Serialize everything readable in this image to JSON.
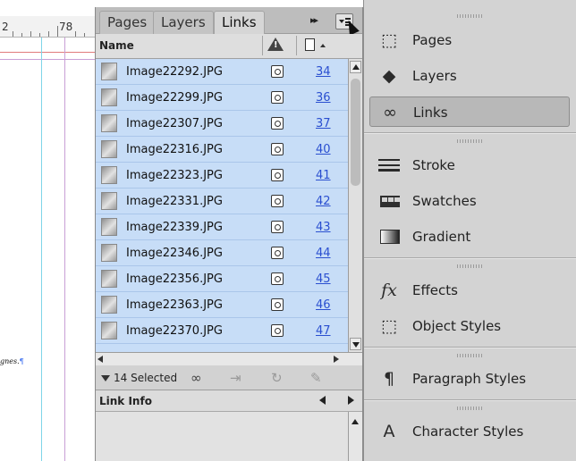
{
  "ruler": {
    "number": "78",
    "partial": "2"
  },
  "doc_snippet": {
    "text": "gnes.",
    "pilcrow": "¶"
  },
  "links_panel": {
    "tabs": [
      {
        "label": "Pages",
        "active": false
      },
      {
        "label": "Layers",
        "active": false
      },
      {
        "label": "Links",
        "active": true
      }
    ],
    "collapse_label": "▸▸",
    "column_name": "Name",
    "rows": [
      {
        "name": "Image22292.JPG",
        "page": "34"
      },
      {
        "name": "Image22299.JPG",
        "page": "36"
      },
      {
        "name": "Image22307.JPG",
        "page": "37"
      },
      {
        "name": "Image22316.JPG",
        "page": "40"
      },
      {
        "name": "Image22323.JPG",
        "page": "41"
      },
      {
        "name": "Image22331.JPG",
        "page": "42"
      },
      {
        "name": "Image22339.JPG",
        "page": "43"
      },
      {
        "name": "Image22346.JPG",
        "page": "44"
      },
      {
        "name": "Image22356.JPG",
        "page": "45"
      },
      {
        "name": "Image22363.JPG",
        "page": "46"
      },
      {
        "name": "Image22370.JPG",
        "page": "47"
      }
    ],
    "selected_label": "14 Selected",
    "link_info_label": "Link Info"
  },
  "dock": {
    "groups": [
      [
        {
          "label": "Pages",
          "icon": "pages-icon",
          "active": false
        },
        {
          "label": "Layers",
          "icon": "layers-icon",
          "active": false
        },
        {
          "label": "Links",
          "icon": "links-icon",
          "active": true
        }
      ],
      [
        {
          "label": "Stroke",
          "icon": "stroke-icon",
          "active": false
        },
        {
          "label": "Swatches",
          "icon": "swatches-icon",
          "active": false
        },
        {
          "label": "Gradient",
          "icon": "gradient-icon",
          "active": false
        }
      ],
      [
        {
          "label": "Effects",
          "icon": "effects-icon",
          "active": false
        },
        {
          "label": "Object Styles",
          "icon": "object-styles-icon",
          "active": false
        }
      ],
      [
        {
          "label": "Paragraph Styles",
          "icon": "paragraph-styles-icon",
          "active": false
        }
      ],
      [
        {
          "label": "Character Styles",
          "icon": "character-styles-icon",
          "active": false
        }
      ]
    ]
  },
  "colors": {
    "selection": "#c7ddf7",
    "page_link": "#2a4fd0",
    "panel_bg": "#d6d6d6"
  }
}
